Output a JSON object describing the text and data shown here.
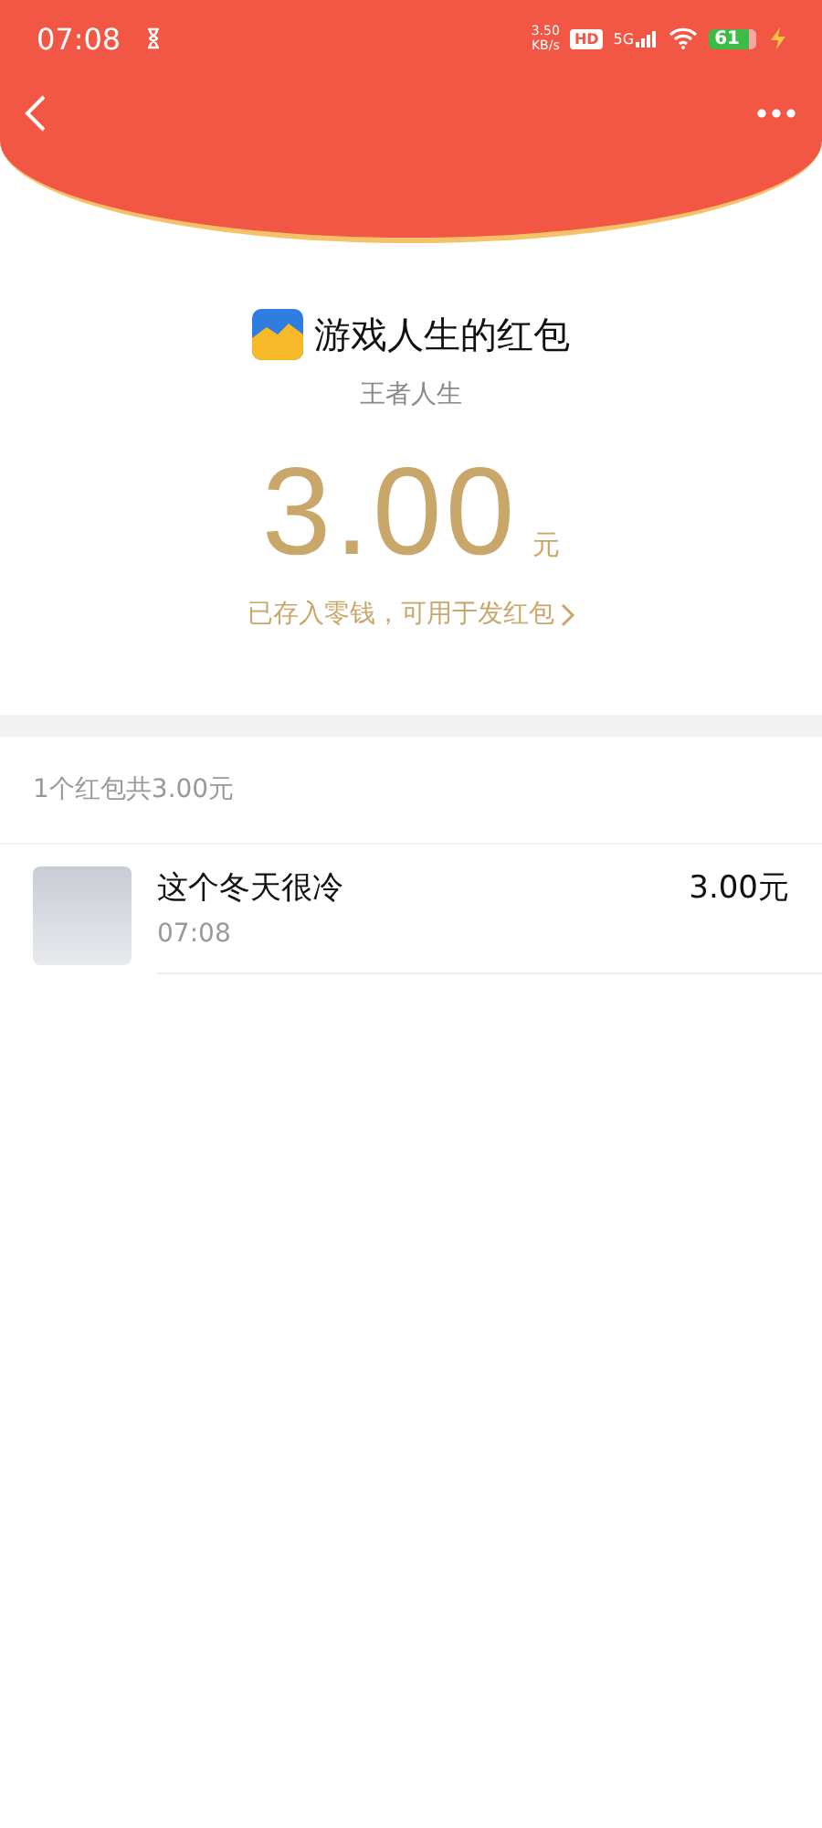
{
  "status_bar": {
    "time": "07:08",
    "net_speed": "3.50",
    "net_unit": "KB/s",
    "hd": "HD",
    "network": "5G",
    "battery": "61"
  },
  "envelope": {
    "title": "游戏人生的红包",
    "sender": "王者人生",
    "amount": "3.00",
    "currency": "元",
    "note": "已存入零钱，可用于发红包"
  },
  "summary": "1个红包共3.00元",
  "records": [
    {
      "name": "这个冬天很冷",
      "time": "07:08",
      "amount": "3.00元"
    }
  ]
}
